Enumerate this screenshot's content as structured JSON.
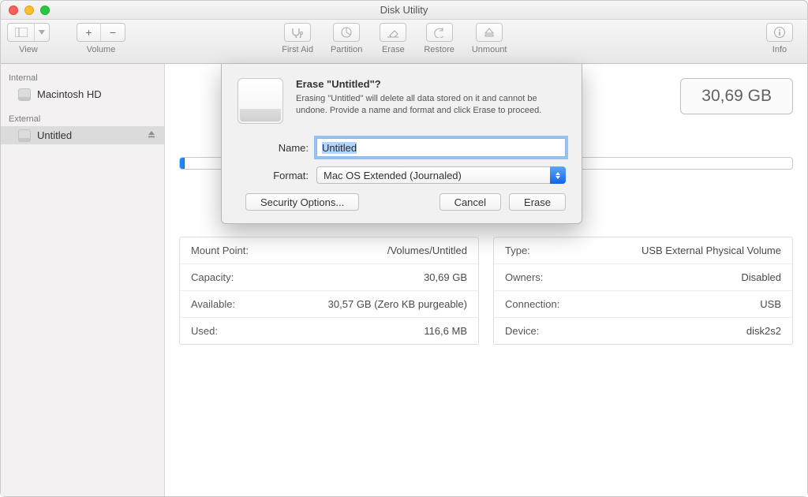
{
  "window": {
    "title": "Disk Utility"
  },
  "toolbar": {
    "view": "View",
    "volume": "Volume",
    "first_aid": "First Aid",
    "partition": "Partition",
    "erase": "Erase",
    "restore": "Restore",
    "unmount": "Unmount",
    "info": "Info"
  },
  "sidebar": {
    "internal_header": "Internal",
    "external_header": "External",
    "items": [
      {
        "label": "Macintosh HD"
      },
      {
        "label": "Untitled"
      }
    ]
  },
  "disk": {
    "badge": "30,69 GB"
  },
  "info_left": [
    {
      "k": "Mount Point:",
      "v": "/Volumes/Untitled"
    },
    {
      "k": "Capacity:",
      "v": "30,69 GB"
    },
    {
      "k": "Available:",
      "v": "30,57 GB (Zero KB purgeable)"
    },
    {
      "k": "Used:",
      "v": "116,6 MB"
    }
  ],
  "info_right": [
    {
      "k": "Type:",
      "v": "USB External Physical Volume"
    },
    {
      "k": "Owners:",
      "v": "Disabled"
    },
    {
      "k": "Connection:",
      "v": "USB"
    },
    {
      "k": "Device:",
      "v": "disk2s2"
    }
  ],
  "sheet": {
    "title": "Erase \"Untitled\"?",
    "body": "Erasing \"Untitled\" will delete all data stored on it and cannot be undone. Provide a name and format and click Erase to proceed.",
    "name_label": "Name:",
    "name_value": "Untitled",
    "format_label": "Format:",
    "format_value": "Mac OS Extended (Journaled)",
    "security_options": "Security Options...",
    "cancel": "Cancel",
    "erase": "Erase"
  }
}
